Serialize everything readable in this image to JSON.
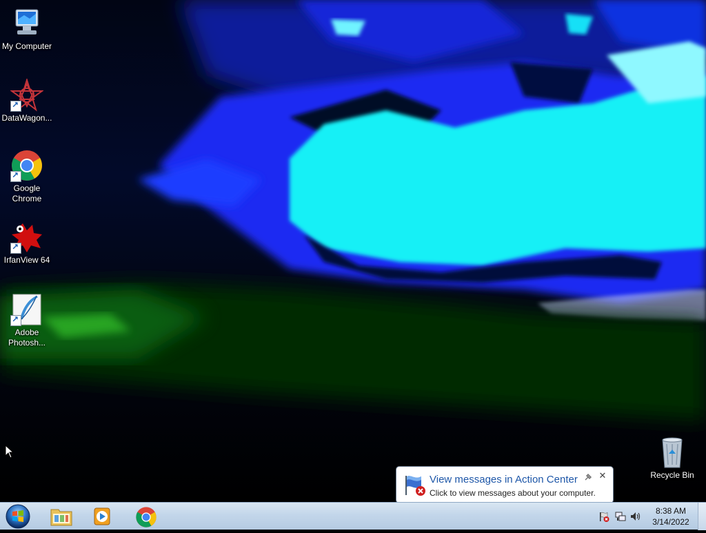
{
  "desktop": {
    "icons": [
      {
        "label": "My Computer",
        "icon": "computer-icon"
      },
      {
        "label": "DataWagon...",
        "icon": "datawagon-icon"
      },
      {
        "label": "Google Chrome",
        "icon": "chrome-icon"
      },
      {
        "label": "IrfanView 64",
        "icon": "irfanview-icon"
      },
      {
        "label": "Adobe Photosh...",
        "icon": "photoshop-icon"
      },
      {
        "label": "Recycle Bin",
        "icon": "recycle-bin-icon"
      }
    ]
  },
  "notification": {
    "title": "View messages in Action Center",
    "message": "Click to view messages about your computer.",
    "close_glyph": "✕"
  },
  "taskbar": {
    "pinned": [
      {
        "icon": "folder-icon"
      },
      {
        "icon": "media-player-icon"
      },
      {
        "icon": "chrome-icon"
      }
    ],
    "clock": {
      "time": "8:38 AM",
      "date": "3/14/2022"
    }
  },
  "colors": {
    "taskbar": "#c3d6ea",
    "balloon_title": "#1e57a8",
    "wallpaper_cyan": "#19f0f6",
    "wallpaper_blue": "#1a2cf2"
  }
}
